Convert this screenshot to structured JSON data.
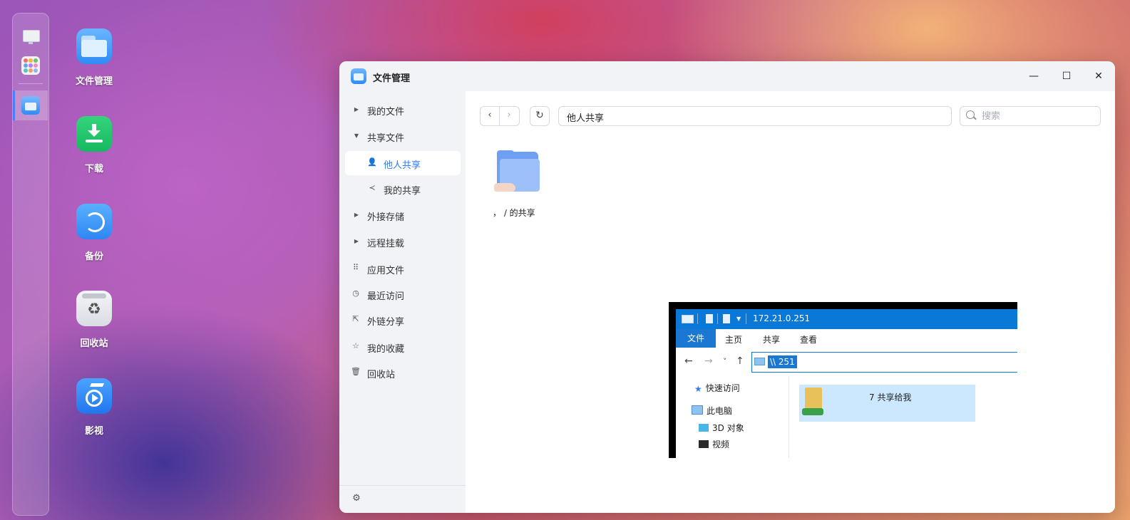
{
  "dock": {
    "items": [
      {
        "icon": "monitor-icon"
      },
      {
        "icon": "app-grid-icon"
      },
      {
        "icon": "file-manager-icon",
        "active": true
      }
    ]
  },
  "desktop": {
    "icons": [
      {
        "label": "文件管理",
        "icon": "folder-icon",
        "color": "#3d95f7"
      },
      {
        "label": "下载",
        "icon": "download-icon",
        "color": "#1fc46a"
      },
      {
        "label": "备份",
        "icon": "backup-icon",
        "color": "#3d95f7"
      },
      {
        "label": "回收站",
        "icon": "recycle-bin-icon",
        "color": "#e7e9ee"
      },
      {
        "label": "影视",
        "icon": "video-icon",
        "color": "#2f86f3"
      }
    ]
  },
  "window": {
    "title": "文件管理",
    "controls": {
      "minimize": "—",
      "maximize": "☐",
      "close": "✕"
    }
  },
  "sidebar": {
    "items": [
      {
        "label": "我的文件",
        "icon": "caret-right-icon"
      },
      {
        "label": "共享文件",
        "icon": "caret-down-icon"
      },
      {
        "label": "他人共享",
        "icon": "users-icon",
        "active": true
      },
      {
        "label": "我的共享",
        "icon": "share-icon"
      },
      {
        "label": "外接存储",
        "icon": "caret-right-icon"
      },
      {
        "label": "远程挂载",
        "icon": "caret-right-icon"
      },
      {
        "label": "应用文件",
        "icon": "apps-icon"
      },
      {
        "label": "最近访问",
        "icon": "clock-icon"
      },
      {
        "label": "外链分享",
        "icon": "external-share-icon"
      },
      {
        "label": "我的收藏",
        "icon": "star-icon"
      },
      {
        "label": "回收站",
        "icon": "trash-icon"
      }
    ]
  },
  "toolbar": {
    "back": "‹",
    "forward": "›",
    "refresh": "↻",
    "path": "他人共享",
    "search_placeholder": "搜索"
  },
  "files": [
    {
      "name": "，    ∕ 的共享",
      "icon": "shared-folder-icon"
    }
  ],
  "explorer_screenshot": {
    "title": "172.21.0.251",
    "ribbon_tabs": [
      "文件",
      "主页",
      "共享",
      "查看"
    ],
    "address": "\\\\         251",
    "nav": {
      "back": "←",
      "forward": "→",
      "dropdown": "˅",
      "up": "↑"
    },
    "tree": [
      "快速访问",
      "此电脑",
      "3D 对象",
      "视频"
    ],
    "item_name": "7 共享给我"
  }
}
